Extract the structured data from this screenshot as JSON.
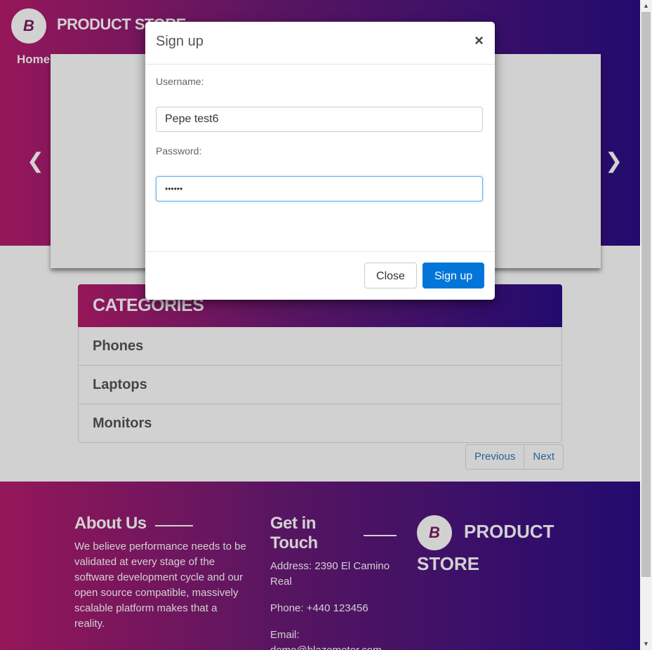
{
  "header": {
    "brand": "PRODUCT STORE",
    "nav_home": "Home",
    "logo_letter": "B"
  },
  "carousel": {
    "prev_icon": "chevron-left-icon",
    "next_icon": "chevron-right-icon"
  },
  "categories": {
    "title": "CATEGORIES",
    "items": [
      "Phones",
      "Laptops",
      "Monitors"
    ]
  },
  "pager": {
    "previous": "Previous",
    "next": "Next"
  },
  "footer": {
    "about_title": "About Us",
    "about_text": "We believe performance needs to be validated at every stage of the software development cycle and our open source compatible, massively scalable platform makes that a reality.",
    "touch_title": "Get in Touch",
    "address": "Address: 2390 El Camino Real",
    "phone": "Phone: +440 123456",
    "email_label": "Email:",
    "email": "demo@blazemeter.com",
    "brand_line1": "PRODUCT",
    "brand_line2": "STORE"
  },
  "modal": {
    "title": "Sign up",
    "close_symbol": "×",
    "username_label": "Username:",
    "username_value": "Pepe test6",
    "password_label": "Password:",
    "password_value": "••••••",
    "close_button": "Close",
    "signup_button": "Sign up"
  },
  "colors": {
    "gradient_start": "#b71d6e",
    "gradient_end": "#2a0e86",
    "primary_button": "#0275d8",
    "link": "#337ab7"
  }
}
